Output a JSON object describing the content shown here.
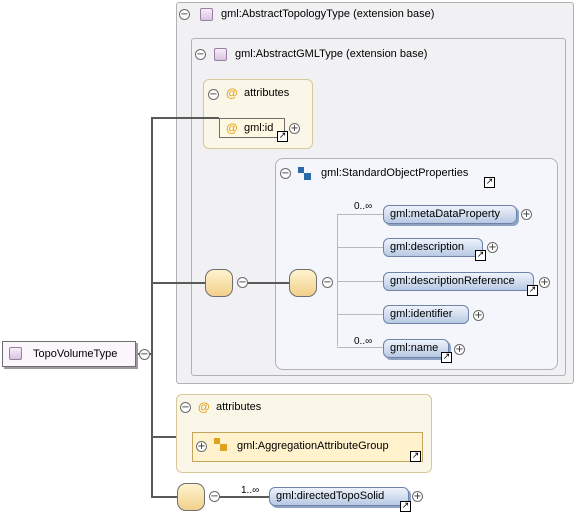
{
  "root": {
    "label": "TopoVolumeType"
  },
  "abstract_topology": {
    "label": "gml:AbstractTopologyType (extension base)"
  },
  "abstract_gml": {
    "label": "gml:AbstractGMLType (extension base)"
  },
  "inner_attributes": {
    "title": "attributes",
    "id_attr": "gml:id"
  },
  "std_props": {
    "label": "gml:StandardObjectProperties",
    "items": [
      {
        "label": "gml:metaDataProperty",
        "cardinality": "0..∞"
      },
      {
        "label": "gml:description",
        "cardinality": ""
      },
      {
        "label": "gml:descriptionReference",
        "cardinality": ""
      },
      {
        "label": "gml:identifier",
        "cardinality": ""
      },
      {
        "label": "gml:name",
        "cardinality": "0..∞"
      }
    ]
  },
  "outer_attributes": {
    "title": "attributes",
    "group": "gml:AggregationAttributeGroup"
  },
  "directed": {
    "label": "gml:directedTopoSolid",
    "cardinality": "1..∞"
  },
  "symbols": {
    "collapse": "⊖",
    "expand": "+",
    "link": "↗",
    "attr": "@"
  }
}
